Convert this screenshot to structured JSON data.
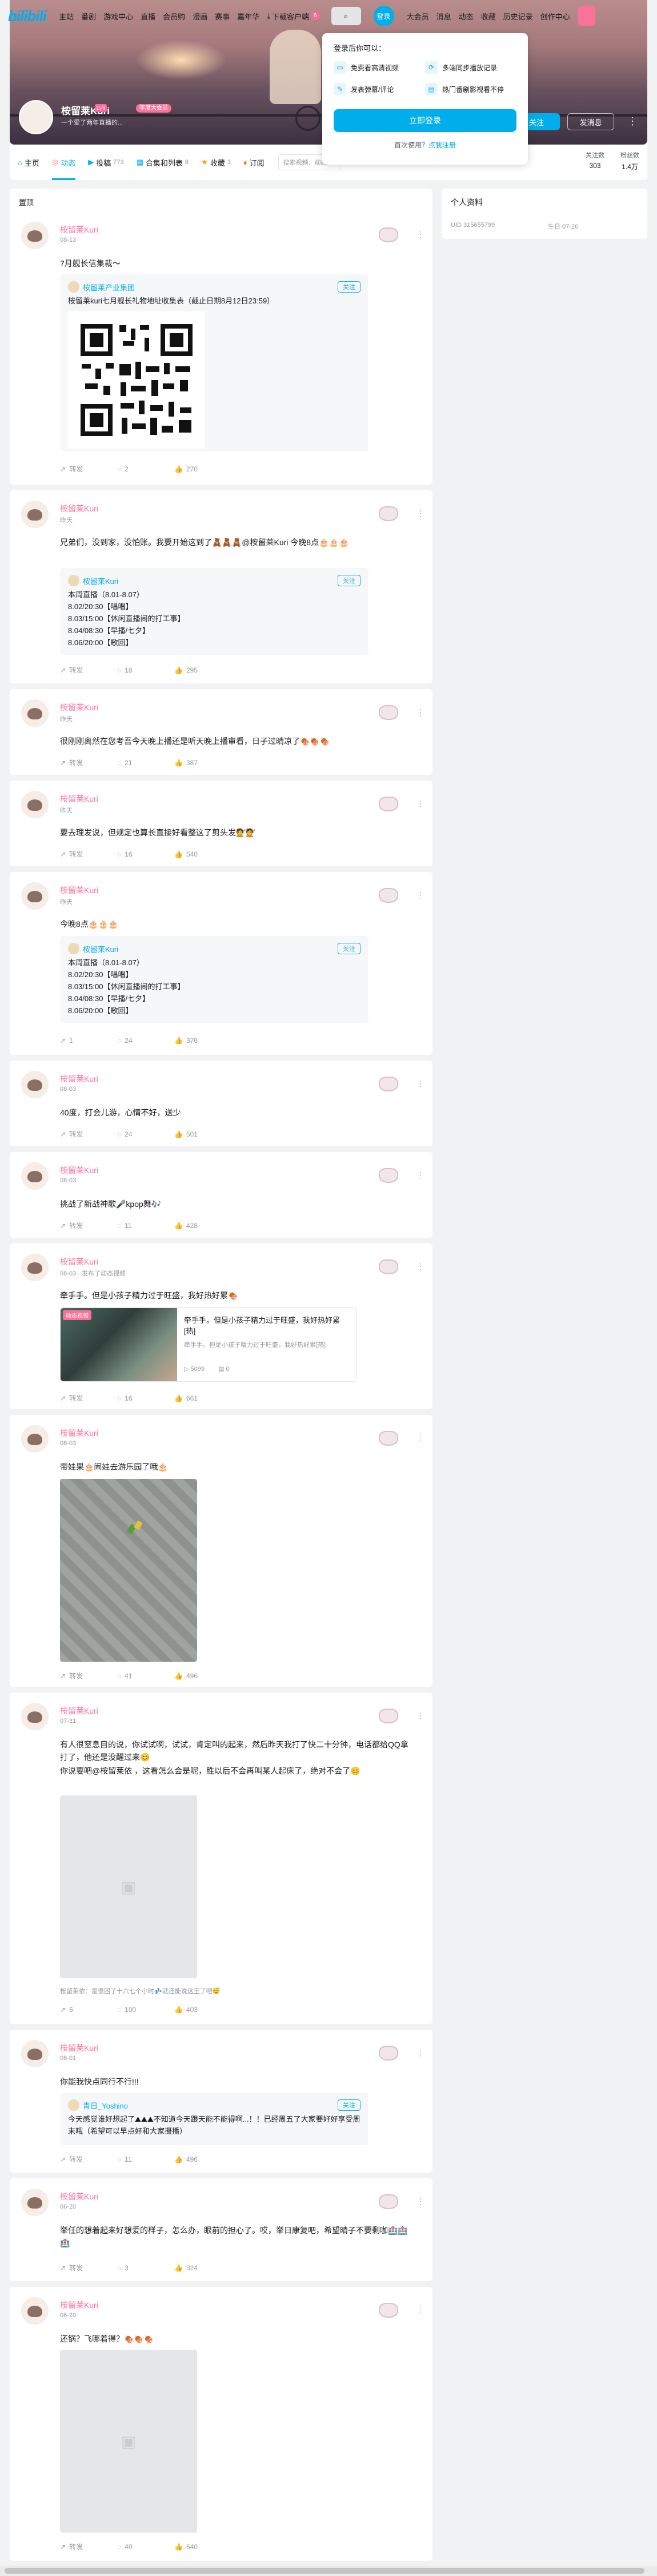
{
  "nav": {
    "logo": "bilibili",
    "links": [
      "主站",
      "番剧",
      "游戏中心",
      "直播",
      "会员购",
      "漫画",
      "赛事",
      "嘉年华"
    ],
    "download_label": "下载客户端",
    "download_badge": "6",
    "login_label": "登录",
    "right_links": [
      "大会员",
      "消息",
      "动态",
      "收藏",
      "历史记录",
      "创作中心"
    ]
  },
  "profile": {
    "name": "桉留莱Kuri",
    "level": "LV6",
    "vip": "年度大会员",
    "sign": "一个爱了两年直播的...",
    "follow_label": "关注",
    "message_label": "发消息",
    "stats": [
      {
        "label": "关注数",
        "value": "303"
      },
      {
        "label": "粉丝数",
        "value": "1.4万"
      }
    ]
  },
  "tabs": [
    {
      "label": "主页",
      "count": ""
    },
    {
      "label": "动态",
      "count": ""
    },
    {
      "label": "投稿",
      "count": "773"
    },
    {
      "label": "合集和列表",
      "count": "8"
    },
    {
      "label": "收藏",
      "count": "3"
    },
    {
      "label": "订阅",
      "count": ""
    }
  ],
  "tab_search_placeholder": "搜索视频、动态",
  "popover": {
    "title": "登录后你可以：",
    "items": [
      "免费看高清视频",
      "多端同步播放记录",
      "发表弹幕/评论",
      "热门番剧影视看不停"
    ],
    "button": "立即登录",
    "register_prefix": "首次使用？",
    "register_link": "点我注册"
  },
  "feed_header": "置顶",
  "sidebar": {
    "title": "个人资料",
    "uid": "UID 315655799",
    "birthday": "生日 07-26"
  },
  "posts": [
    {
      "name": "桉留莱Kuri",
      "time": "08-13",
      "text": "7月舰长信集裁～",
      "quote_name": "桉留莱产业集团",
      "quote_lines": [
        "桉留莱kuri七月舰长礼物地址收集表（截止日期8月12日23:59）"
      ],
      "actions": [
        "转发",
        "2",
        "270"
      ]
    },
    {
      "name": "桉留莱Kuri",
      "time": "昨天",
      "text": "兄弟们，没到家，没怕账。我要开始这到了🧸🧸🧸@桉留莱Kuri 今晚8点🎂🎂🎂",
      "quote_name": "桉留莱Kuri",
      "quote_lines": [
        "本周直播（8.01-8.07）",
        "8.02/20:30【唱唱】",
        "8.03/15:00【休闲直播间的打工事】",
        "8.04/08:30【早播/七夕】",
        "8.06/20:00【歌回】"
      ],
      "actions": [
        "转发",
        "18",
        "295"
      ]
    },
    {
      "name": "桉留莱Kuri",
      "time": "昨天",
      "text": "很刚刚离然在您考吾今天晚上播还是听天晚上播审看，日子过晴凉了🍖🍖🍖",
      "actions": [
        "转发",
        "21",
        "387"
      ]
    },
    {
      "name": "桉留莱Kuri",
      "time": "昨天",
      "text": "要去理发说，但规定也算长直接好看整这了剪头发💇💇",
      "actions": [
        "转发",
        "16",
        "540"
      ]
    },
    {
      "name": "桉留莱Kuri",
      "time": "昨天",
      "text": "今晚8点🎂🎂🎂",
      "quote_name": "桉留莱Kuri",
      "quote_lines": [
        "本周直播（8.01-8.07）",
        "8.02/20:30【唱唱】",
        "8.03/15:00【休闲直播间的打工事】",
        "8.04/08:30【早播/七夕】",
        "8.06/20:00【歌回】"
      ],
      "actions": [
        "1",
        "24",
        "376"
      ]
    },
    {
      "name": "桉留莱Kuri",
      "time": "08-03",
      "text": "40度，打会儿游，心情不好，送少",
      "actions": [
        "转发",
        "24",
        "501"
      ]
    },
    {
      "name": "桉留莱Kuri",
      "time": "08-03",
      "text": "挑战了新战神歌🎤kpop舞🎶",
      "actions": [
        "转发",
        "11",
        "428"
      ]
    },
    {
      "name": "桉留莱Kuri",
      "time": "08-03 · 发布了动态视频",
      "text": "牵手手。但是小孩子精力过于旺盛，我好热好累🍖",
      "video_title": "牵手手。但是小孩子精力过于旺盛，我好热好累[热]",
      "video_desc": "牵手手。但是小孩子精力过于旺盛，我好热好累[热]",
      "video_badge": "动态视频",
      "video_stats": [
        "5099",
        "0"
      ],
      "actions": [
        "转发",
        "16",
        "661"
      ]
    },
    {
      "name": "桉留莱Kuri",
      "time": "08-03",
      "text": "带娃果🎂闹娃去游乐园了哦🎂",
      "actions": [
        "转发",
        "41",
        "496"
      ]
    },
    {
      "name": "桉留莱Kuri",
      "time": "07-31",
      "text": "有人很窒息目的说，你试试啊，试试，肯定叫的起来，然后昨天我打了快二十分钟，电话都给QQ拿打了，他还是没醒过来😊",
      "text2": "你说要吧@桉留莱依 ，这看怎么会是呢，胜以后不会再叫某人起床了，绝对不会了😊",
      "comment_hint": "桉留莱依：是很困了十六七个小时💤就还能说这王了吧😴",
      "actions": [
        "6",
        "100",
        "403"
      ]
    },
    {
      "name": "桉留莱Kuri",
      "time": "08-01",
      "text": "你能我快点同行不行!!!",
      "quote_name": "青日_Yoshino",
      "quote_lines": [
        "今天感觉谁好想起了⛰⛰⛰不知道今天跟天能不能得啊...！！已经周五了大家要好好享受周末哦（希望可以早点好和大家摄播）"
      ],
      "actions": [
        "转发",
        "11",
        "496"
      ]
    },
    {
      "name": "桉留莱Kuri",
      "time": "06-20",
      "text": "举任的想着起来好想爱的样子，怎么办，眼前的担心了。哎，举日康复吧，希望晴子不要剩咖🏥🏥🏥",
      "actions": [
        "转发",
        "3",
        "324"
      ]
    },
    {
      "name": "桉留莱Kuri",
      "time": "06-20",
      "text": "还锅？飞哪着得？🍖🍖🍖",
      "actions": [
        "转发",
        "40",
        "640"
      ]
    }
  ]
}
